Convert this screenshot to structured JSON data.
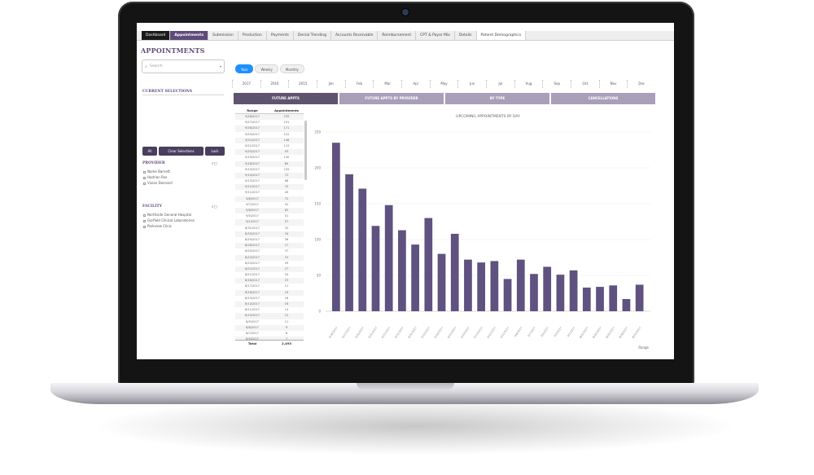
{
  "tabs": [
    {
      "label": "Dashboard",
      "style": "dark"
    },
    {
      "label": "Appointments",
      "style": "active"
    },
    {
      "label": "Submission",
      "style": ""
    },
    {
      "label": "Production",
      "style": ""
    },
    {
      "label": "Payments",
      "style": ""
    },
    {
      "label": "Denial Trending",
      "style": ""
    },
    {
      "label": "Accounts Receivable",
      "style": ""
    },
    {
      "label": "Reimbursement",
      "style": ""
    },
    {
      "label": "CPT & Payor Mix",
      "style": ""
    },
    {
      "label": "Details",
      "style": ""
    },
    {
      "label": "Patient Demographics",
      "style": "light"
    }
  ],
  "app": {
    "title": "APPOINTMENTS"
  },
  "search": {
    "placeholder": "Search"
  },
  "current_selections": {
    "title": "CURRENT SELECTIONS"
  },
  "selection_buttons": [
    "All",
    "Clear Selections",
    "Lock"
  ],
  "filters": {
    "provider": {
      "title": "PROVIDER",
      "items": [
        "Name Barnett",
        "Hadrian Rex",
        "Vivian Donnard"
      ]
    },
    "facility": {
      "title": "FACILITY",
      "items": [
        "Northside General Hospital",
        "Garfield Clinical Laboratories",
        "Parkview Clinic"
      ]
    }
  },
  "period_toggle": [
    {
      "label": "Year",
      "active": true
    },
    {
      "label": "Weekly",
      "active": false
    },
    {
      "label": "Monthly",
      "active": false
    }
  ],
  "date_filters": [
    "2017",
    "2016",
    "2015",
    "Jan",
    "Feb",
    "Mar",
    "Apr",
    "May",
    "Jun",
    "Jul",
    "Aug",
    "Sep",
    "Oct",
    "Nov",
    "Dec"
  ],
  "view_tabs": [
    {
      "label": "FUTURE APPTS",
      "selected": true
    },
    {
      "label": "FUTURE APPTS BY PROVIDER",
      "selected": false
    },
    {
      "label": "BY TYPE",
      "selected": false
    },
    {
      "label": "CANCELLATIONS",
      "selected": false
    }
  ],
  "table": {
    "headers": [
      "Range",
      "Appointments"
    ],
    "rows": [
      [
        "9/28/2017",
        "235"
      ],
      [
        "9/27/2017",
        "191"
      ],
      [
        "9/26/2017",
        "171"
      ],
      [
        "9/25/2017",
        "122"
      ],
      [
        "9/22/2017",
        "148"
      ],
      [
        "9/21/2017",
        "115"
      ],
      [
        "9/20/2017",
        "93"
      ],
      [
        "9/19/2017",
        "130"
      ],
      [
        "9/18/2017",
        "80"
      ],
      [
        "9/15/2017",
        "105"
      ],
      [
        "9/14/2017",
        "72"
      ],
      [
        "9/13/2017",
        "68"
      ],
      [
        "9/12/2017",
        "70"
      ],
      [
        "9/11/2017",
        "45"
      ],
      [
        "9/8/2017",
        "72"
      ],
      [
        "9/7/2017",
        "52"
      ],
      [
        "9/6/2017",
        "62"
      ],
      [
        "9/5/2017",
        "51"
      ],
      [
        "9/1/2017",
        "57"
      ],
      [
        "8/31/2017",
        "33"
      ],
      [
        "8/30/2017",
        "34"
      ],
      [
        "8/29/2017",
        "36"
      ],
      [
        "8/28/2017",
        "17"
      ],
      [
        "8/25/2017",
        "37"
      ],
      [
        "8/24/2017",
        "31"
      ],
      [
        "8/23/2017",
        "29"
      ],
      [
        "8/22/2017",
        "27"
      ],
      [
        "8/21/2017",
        "24"
      ],
      [
        "8/18/2017",
        "23"
      ],
      [
        "8/17/2017",
        "21"
      ],
      [
        "8/16/2017",
        "19"
      ],
      [
        "8/15/2017",
        "18"
      ],
      [
        "8/14/2017",
        "16"
      ],
      [
        "8/11/2017",
        "14"
      ],
      [
        "8/10/2017",
        "12"
      ],
      [
        "8/9/2017",
        "11"
      ],
      [
        "8/8/2017",
        "9"
      ],
      [
        "8/7/2017",
        "8"
      ],
      [
        "8/4/2017",
        "7"
      ]
    ],
    "total_label": "Total",
    "total_value": "2,493"
  },
  "chart_data": {
    "type": "bar",
    "title": "UPCOMING APPOINTMENTS BY DAY",
    "xlabel": "Range",
    "ylabel": "",
    "ylim": [
      0,
      250
    ],
    "yticks": [
      0,
      50,
      100,
      150,
      200,
      250
    ],
    "grid": true,
    "color": "#5f5280",
    "categories": [
      "9/28/2017",
      "9/27/2017",
      "9/26/2017",
      "9/25/2017",
      "9/22/2017",
      "9/21/2017",
      "9/20/2017",
      "9/19/2017",
      "9/18/2017",
      "9/15/2017",
      "9/14/2017",
      "9/13/2017",
      "9/12/2017",
      "9/11/2017",
      "9/8/2017",
      "9/7/2017",
      "9/6/2017",
      "9/5/2017",
      "9/1/2017",
      "8/31/2017",
      "8/30/2017",
      "8/29/2017",
      "8/28/2017",
      "8/25/2017"
    ],
    "values": [
      235,
      191,
      171,
      119,
      148,
      113,
      93,
      130,
      80,
      108,
      72,
      68,
      70,
      45,
      72,
      52,
      62,
      51,
      57,
      33,
      34,
      36,
      17,
      37
    ]
  }
}
